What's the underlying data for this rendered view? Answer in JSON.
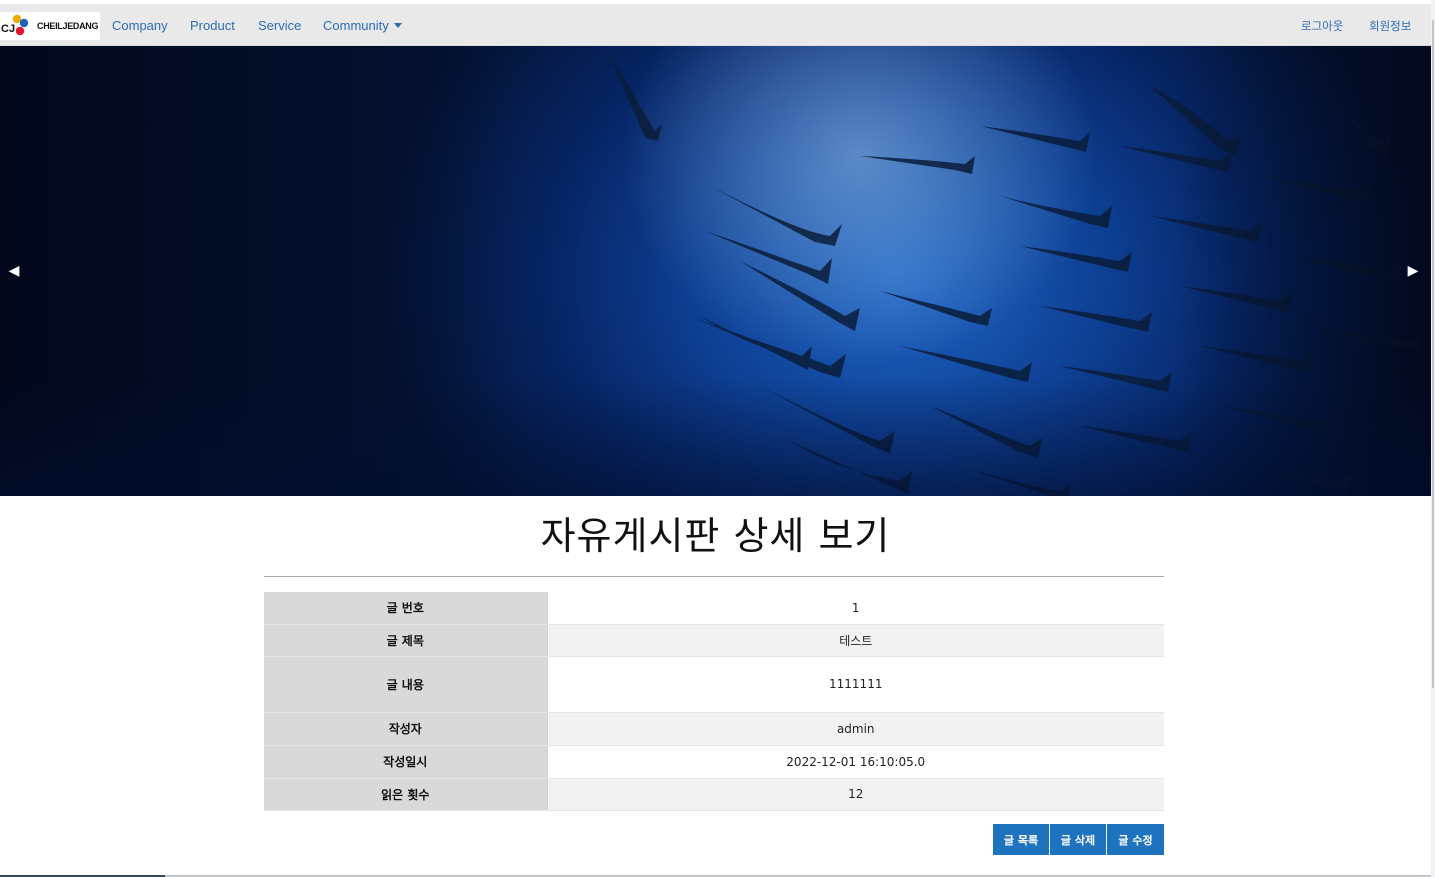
{
  "brand": {
    "logo_text": "CHEILJEDANG",
    "logo_mark": "CJ",
    "accent": "#2b6cb0"
  },
  "nav": {
    "company": "Company",
    "product": "Product",
    "service": "Service",
    "community": "Community",
    "logout": "로그아웃",
    "member_info": "회원정보"
  },
  "carousel": {
    "prev": "◀",
    "next": "▶"
  },
  "page": {
    "title": "자유게시판 상세 보기"
  },
  "post": {
    "rows": [
      {
        "label": "글 번호",
        "value": "1"
      },
      {
        "label": "글 제목",
        "value": "테스트"
      },
      {
        "label": "글 내용",
        "value": "1111111"
      },
      {
        "label": "작성자",
        "value": "admin"
      },
      {
        "label": "작성일시",
        "value": "2022-12-01 16:10:05.0"
      },
      {
        "label": "읽은 횟수",
        "value": "12"
      }
    ]
  },
  "actions": {
    "list": "글 목록",
    "delete": "글 삭제",
    "edit": "글 수정",
    "button_color": "#1e73be"
  }
}
